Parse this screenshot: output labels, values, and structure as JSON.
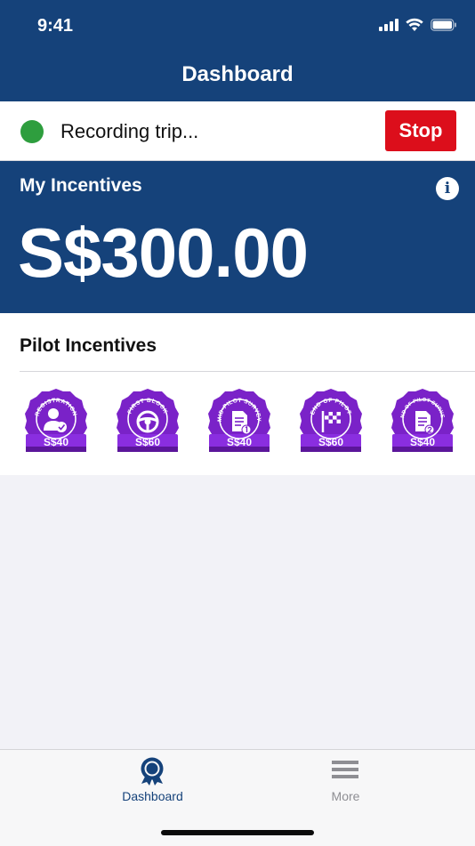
{
  "status_bar": {
    "time": "9:41"
  },
  "nav": {
    "title": "Dashboard"
  },
  "recording": {
    "status_text": "Recording trip...",
    "stop_label": "Stop",
    "indicator_color": "#2e9e3e"
  },
  "incentives": {
    "label": "My Incentives",
    "amount": "S$300.00"
  },
  "pilot": {
    "title": "Pilot Incentives",
    "badges": [
      {
        "arc_text": "REGISTRATION",
        "icon": "user-check-icon",
        "amount": "S$40"
      },
      {
        "arc_text": "FIRST BLOCK",
        "icon": "steering-wheel-icon",
        "amount": "S$60"
      },
      {
        "arc_text": "MID-PILOT SURVEY",
        "icon": "survey-1-icon",
        "amount": "S$40"
      },
      {
        "arc_text": "END OF PILOT",
        "icon": "checkered-flag-icon",
        "amount": "S$60"
      },
      {
        "arc_text": "END OF PILOT SURVEY",
        "icon": "survey-2-icon",
        "amount": "S$40"
      }
    ]
  },
  "tabs": [
    {
      "label": "Dashboard",
      "icon": "award-icon",
      "active": true
    },
    {
      "label": "More",
      "icon": "menu-icon",
      "active": false
    }
  ],
  "colors": {
    "brand": "#15427a",
    "stop": "#dc0e1b",
    "badge_purple": "#7a22c8"
  }
}
